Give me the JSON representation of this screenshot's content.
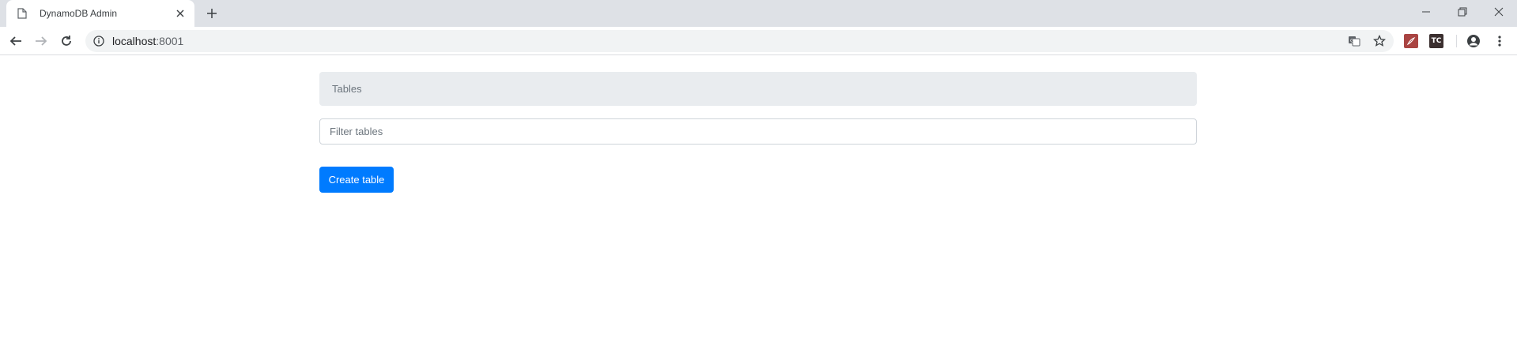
{
  "browser": {
    "tab": {
      "title": "DynamoDB Admin",
      "icon": "page-icon"
    },
    "new_tab_icon": "plus-icon",
    "window_controls": [
      "minimize-icon",
      "restore-icon",
      "close-icon"
    ],
    "address": {
      "host": "localhost",
      "port": ":8001",
      "icon": "info-icon"
    },
    "extensions": [
      {
        "name": "acrobat-extension-icon",
        "color": "#a94442"
      },
      {
        "name": "tc-extension-icon",
        "label": "TC",
        "color": "#3b2f2f"
      }
    ]
  },
  "page": {
    "breadcrumb": {
      "label": "Tables"
    },
    "filter": {
      "placeholder": "Filter tables",
      "value": ""
    },
    "create_button": {
      "label": "Create table"
    }
  },
  "colors": {
    "primary": "#007bff",
    "breadcrumb_bg": "#e9ecef",
    "tabstrip_bg": "#dee1e6"
  }
}
